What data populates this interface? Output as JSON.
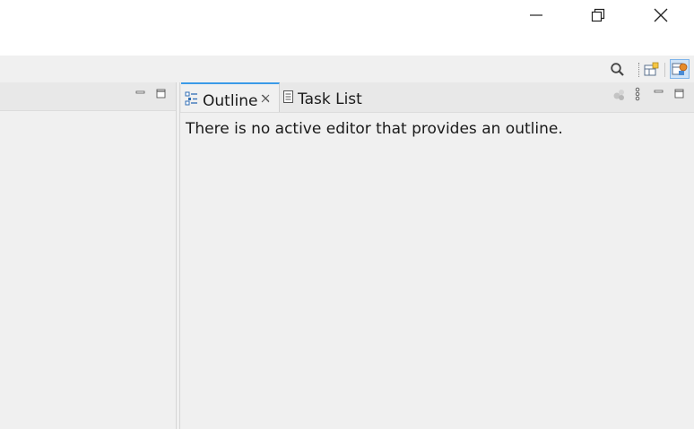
{
  "window": {
    "controls": [
      {
        "name": "minimize",
        "icon": "minimize-icon"
      },
      {
        "name": "restore",
        "icon": "restore-icon"
      },
      {
        "name": "close",
        "icon": "close-icon"
      }
    ]
  },
  "toolbar": {
    "icons": [
      "search-icon",
      "open-perspective-icon",
      "perspective-icon"
    ]
  },
  "right_panel": {
    "tabs": [
      {
        "label": "Outline",
        "active": true,
        "icon": "outline-icon",
        "closable": true
      },
      {
        "label": "Task List",
        "active": false,
        "icon": "task-list-icon",
        "closable": false
      }
    ],
    "message": "There is no active editor that provides an outline."
  },
  "colors": {
    "active_tab_accent": "#3a9ae8",
    "background": "#f0f0f0",
    "titlebar": "#ffffff"
  }
}
